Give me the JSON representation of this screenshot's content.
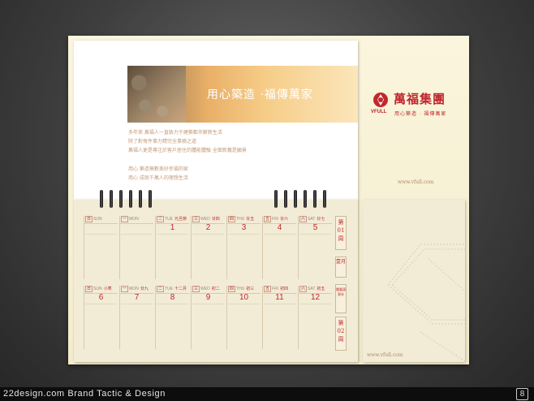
{
  "banner": {
    "slogan": "用心築造 ·福傳萬家"
  },
  "intro": {
    "lines": [
      "多年來  萬福人一直致力于建築都市嶄新生活",
      "除了對每件事力精完全事務之道",
      "萬福人更是專注於客戶居住的體能體驗  全面新義是願景",
      "用心  築造無數美好幸福的家",
      "用心  成就千萬人的理想生活"
    ]
  },
  "logo": {
    "name_cn": "萬福集團",
    "name_en": "VFULL",
    "tagline": "用心築造 · 福傳萬家"
  },
  "urls": {
    "top": "www.vfull.com",
    "bottom": "www.vfull.com"
  },
  "calendar": {
    "week1": [
      {
        "wk": "日",
        "en": "SUN",
        "lunar": "",
        "num": ""
      },
      {
        "wk": "一",
        "en": "MON",
        "lunar": "",
        "num": ""
      },
      {
        "wk": "二",
        "en": "TUE",
        "lunar": "元旦節",
        "num": "1"
      },
      {
        "wk": "三",
        "en": "WED",
        "lunar": "廿四",
        "num": "2"
      },
      {
        "wk": "四",
        "en": "THU",
        "lunar": "廿五",
        "num": "3"
      },
      {
        "wk": "五",
        "en": "FRI",
        "lunar": "廿六",
        "num": "4"
      },
      {
        "wk": "六",
        "en": "SAT",
        "lunar": "廿七",
        "num": "5"
      }
    ],
    "week2": [
      {
        "wk": "日",
        "en": "SUN",
        "lunar": "小寒",
        "num": "6"
      },
      {
        "wk": "一",
        "en": "MON",
        "lunar": "廿九",
        "num": "7"
      },
      {
        "wk": "二",
        "en": "TUE",
        "lunar": "十二月",
        "num": "8"
      },
      {
        "wk": "三",
        "en": "WED",
        "lunar": "初二",
        "num": "9"
      },
      {
        "wk": "四",
        "en": "THU",
        "lunar": "初三",
        "num": "10"
      },
      {
        "wk": "五",
        "en": "FRI",
        "lunar": "初四",
        "num": "11"
      },
      {
        "wk": "六",
        "en": "SAT",
        "lunar": "初五",
        "num": "12"
      }
    ],
    "side": {
      "week1": "第01周",
      "month": "壹月",
      "year": "農曆庚寅年",
      "week2": "第02周"
    }
  },
  "footer": {
    "text": "22design.com Brand Tactic & Design",
    "icon_label": "8"
  },
  "colors": {
    "accent": "#c0282d",
    "board": "#f5eed2",
    "text_warm": "#c29a79"
  }
}
